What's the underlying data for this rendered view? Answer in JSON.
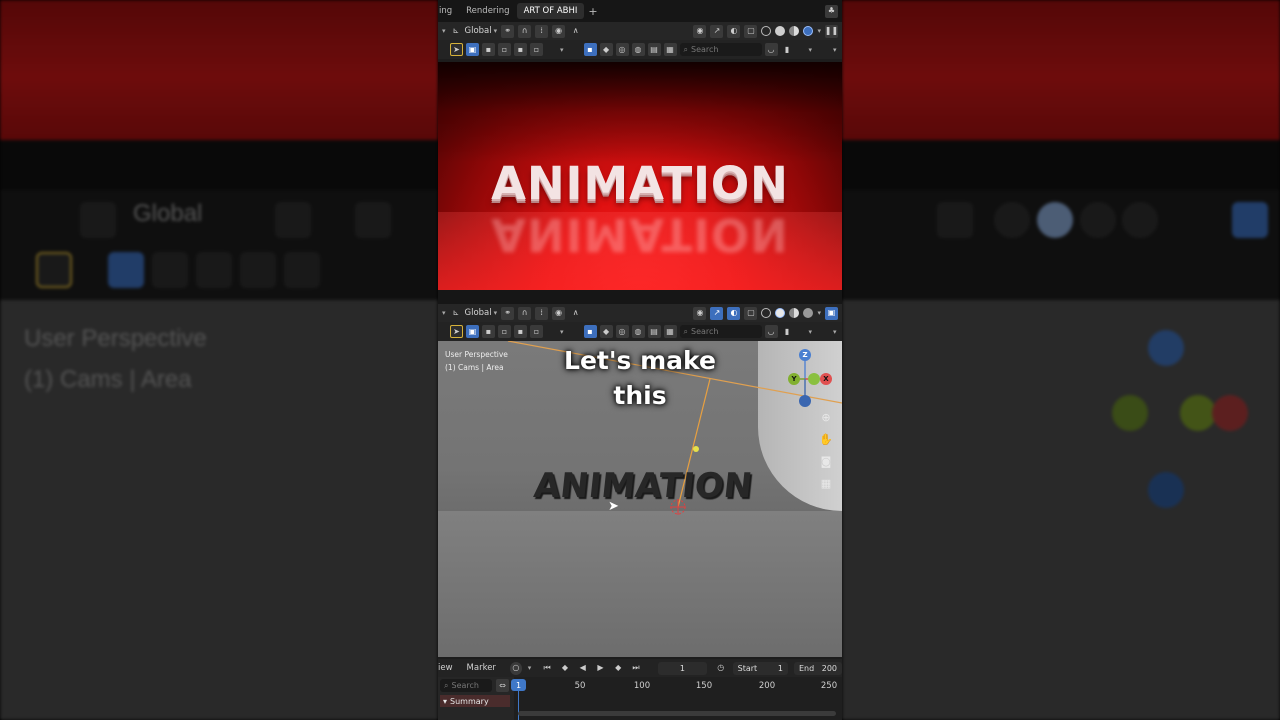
{
  "workspace_tabs": [
    "ing",
    "Rendering",
    "ART OF ABHI"
  ],
  "active_tab": "ART OF ABHI",
  "add_tab": "+",
  "header": {
    "transform_orientation": "Global",
    "search_placeholder": "Search"
  },
  "render_preview": {
    "title_text": "ANIMATION",
    "background_color": "#e01111"
  },
  "viewport": {
    "view_name": "User Perspective",
    "object_info": "(1) Cams | Area",
    "caption_line1": "Let's make",
    "caption_line2": "this",
    "object_text": "ANIMATION",
    "gizmo": {
      "z": "Z",
      "y": "Y",
      "x": "X"
    }
  },
  "timeline": {
    "view_label": "iew",
    "marker_label": "Marker",
    "current_frame": "1",
    "start_label": "Start",
    "start_value": "1",
    "end_label": "End",
    "end_value": "200",
    "search_placeholder": "Search",
    "summary_label": "Summary",
    "ruler_ticks": [
      "1",
      "50",
      "100",
      "150",
      "200",
      "250"
    ]
  },
  "background_blur": {
    "global_label": "Global",
    "view_name": "User Perspective",
    "object_info": "(1) Cams | Area"
  },
  "colors": {
    "accent": "#3d6fbd",
    "render_red": "#e01111",
    "selection_yellow": "#d6b23a"
  }
}
